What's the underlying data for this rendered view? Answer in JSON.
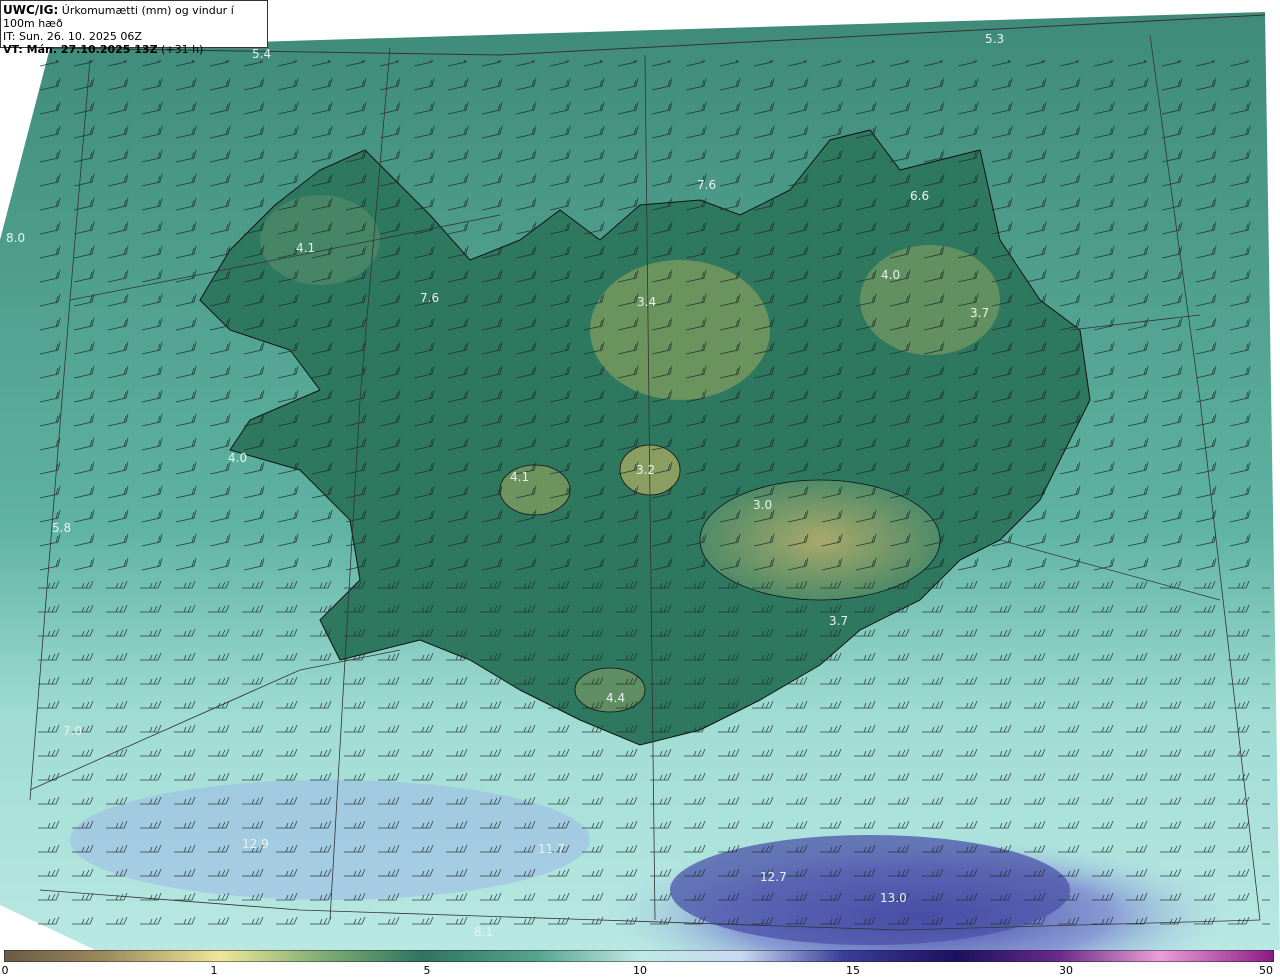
{
  "header": {
    "product": "UWC/IG:",
    "title": "Úrkomumætti (mm) og vindur í 100m hæð",
    "init_time": "IT: Sun. 26. 10. 2025 06Z",
    "valid_label": "VT: Mán. 27.10.2025 13Z",
    "lead": "(+31 h)"
  },
  "map_values": [
    "5.4",
    "5.3",
    "8.0",
    "7.6",
    "6.6",
    "4.1",
    "4.0",
    "3.4",
    "3.7",
    "4.0",
    "4.1",
    "3.2",
    "3.0",
    "3.7",
    "4.4",
    "7.0",
    "12.9",
    "11.7",
    "12.7",
    "13.0",
    "8.1",
    "7.6",
    "5.8"
  ],
  "colorbar": {
    "ticks": [
      "0",
      "1",
      "5",
      "10",
      "15",
      "30",
      "50"
    ],
    "colors": [
      "#6b5a44",
      "#b8a66b",
      "#f0e69a",
      "#4e8f6a",
      "#2e7561",
      "#56a58f",
      "#bfe9e5",
      "#c9d8f3",
      "#3a3f9a",
      "#1b1060",
      "#6a2a8a",
      "#ea9fd8",
      "#8c1a86"
    ]
  },
  "colors": {
    "ocean": "#4a9a8a",
    "land_low": "#2f7860",
    "land_high": "#9aa560",
    "precip_heavy": "#5560b8",
    "coast": "#111111"
  }
}
